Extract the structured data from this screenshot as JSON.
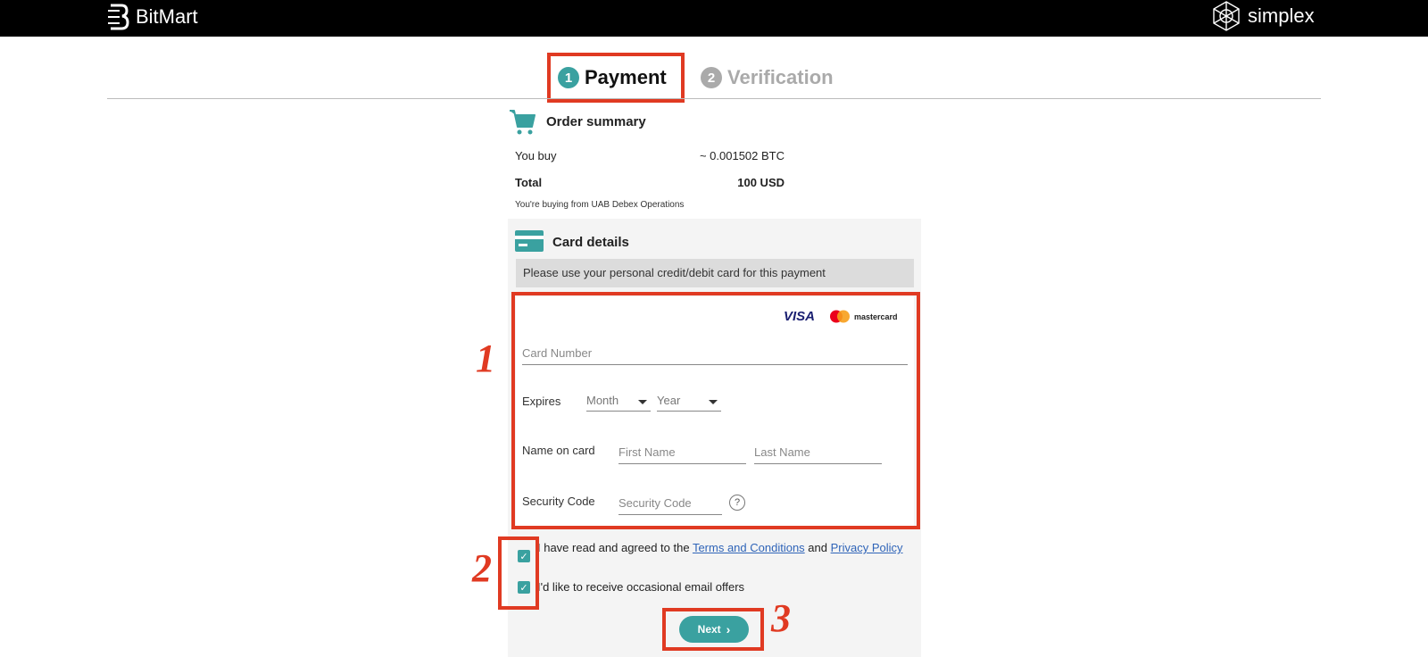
{
  "header": {
    "brand": "BitMart",
    "partner": "simplex"
  },
  "steps": [
    {
      "number": "1",
      "label": "Payment",
      "active": true
    },
    {
      "number": "2",
      "label": "Verification",
      "active": false
    }
  ],
  "order_summary": {
    "title": "Order summary",
    "rows": [
      {
        "label": "You buy",
        "value": "~ 0.001502 BTC"
      },
      {
        "label": "Total",
        "value": "100 USD"
      }
    ],
    "seller_note": "You're buying from UAB Debex Operations"
  },
  "card_details": {
    "title": "Card details",
    "notice": "Please use your personal credit/debit card for this payment",
    "brands": [
      "VISA",
      "mastercard"
    ],
    "card_number_placeholder": "Card Number",
    "expires_label": "Expires",
    "month_placeholder": "Month",
    "year_placeholder": "Year",
    "name_label": "Name on card",
    "first_name_placeholder": "First Name",
    "last_name_placeholder": "Last Name",
    "security_label": "Security Code",
    "security_placeholder": "Security Code",
    "help_icon": "?"
  },
  "consents": {
    "terms_prefix": "I have read and agreed to the ",
    "terms_link": "Terms and Conditions",
    "terms_mid": " and ",
    "privacy_link": "Privacy Policy",
    "offers": "I'd like to receive occasional email offers",
    "terms_checked": true,
    "offers_checked": true
  },
  "next_button": "Next",
  "annotations": [
    "1",
    "2",
    "3"
  ],
  "colors": {
    "accent": "#3aa1a0",
    "highlight": "#e03a22",
    "link": "#2f64b8"
  }
}
